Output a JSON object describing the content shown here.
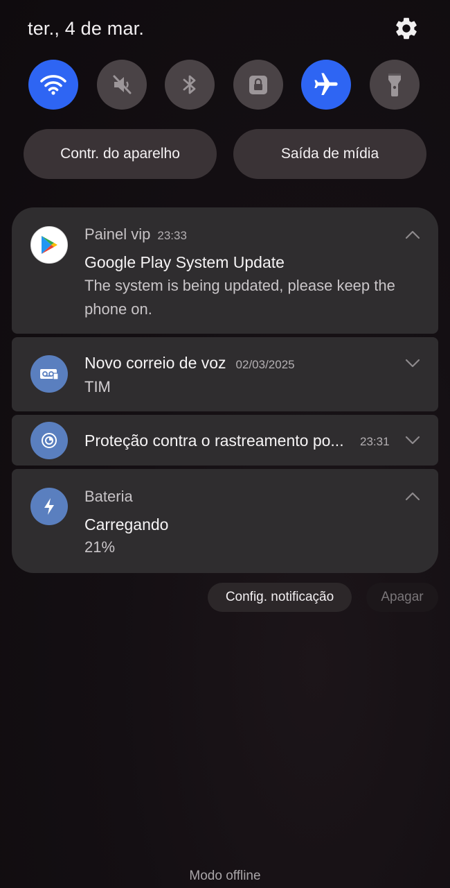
{
  "header": {
    "date": "ter., 4 de mar."
  },
  "quick_toggles": [
    {
      "name": "wifi",
      "icon": "wifi-icon",
      "state": "on"
    },
    {
      "name": "sound",
      "icon": "sound-off-icon",
      "state": "off"
    },
    {
      "name": "bluetooth",
      "icon": "bluetooth-icon",
      "state": "off"
    },
    {
      "name": "rotation-lock",
      "icon": "lock-rotation-icon",
      "state": "off"
    },
    {
      "name": "airplane-mode",
      "icon": "airplane-icon",
      "state": "on"
    },
    {
      "name": "flashlight",
      "icon": "flashlight-icon",
      "state": "off"
    }
  ],
  "pills": {
    "device_control": "Contr. do aparelho",
    "media_output": "Saída de mídia"
  },
  "notifications": [
    {
      "app": "Painel vip",
      "time": "23:33",
      "title": "Google Play System Update",
      "body": "The system is being updated, please keep the phone on.",
      "icon": "google-play-icon",
      "expanded": true
    },
    {
      "app": "Novo correio de voz",
      "time": "02/03/2025",
      "body": "TIM",
      "icon": "voicemail-icon",
      "expanded": false
    },
    {
      "app": "Proteção contra o rastreamento po...",
      "time": "23:31",
      "icon": "tracking-protection-icon",
      "expanded": false
    },
    {
      "app": "Bateria",
      "title": "Carregando",
      "body": "21%",
      "icon": "battery-charging-icon",
      "expanded": true
    }
  ],
  "actions": {
    "settings": "Config. notificação",
    "clear": "Apagar"
  },
  "footer": {
    "status": "Modo offline"
  },
  "colors": {
    "accent_on": "#2e65f3",
    "toggle_off": "#4a4346",
    "card": "#2f2d2f",
    "icon_badge": "#5a7fbf"
  }
}
